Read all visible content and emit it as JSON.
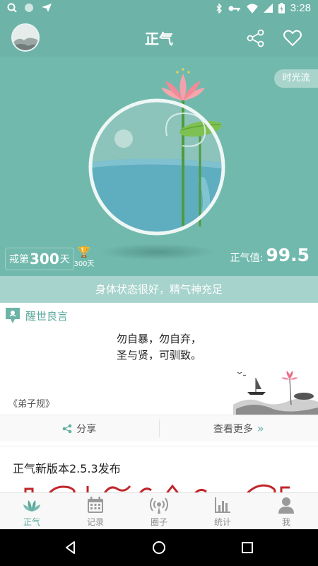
{
  "status_bar": {
    "time": "3:28"
  },
  "header": {
    "title": "正气"
  },
  "hero": {
    "timeflow_label": "时光流",
    "streak_prefix": "戒第",
    "streak_days": "300",
    "streak_suffix": "天",
    "trophy_label": "300天",
    "score_label": "正气值:",
    "score_value": "99.5",
    "water_level": 0.55
  },
  "banner": {
    "text": "身体状态很好，精气神充足"
  },
  "quote": {
    "title": "醒世良言",
    "line1": "勿自暴，勿自弃，",
    "line2": "圣与贤，可驯致。",
    "source": "《弟子规》",
    "share_label": "分享",
    "more_label": "查看更多"
  },
  "news": {
    "title": "正气新版本2.5.3发布"
  },
  "tabs": [
    {
      "label": "正气",
      "icon": "lotus-icon",
      "active": true
    },
    {
      "label": "记录",
      "icon": "calendar-icon",
      "active": false
    },
    {
      "label": "圈子",
      "icon": "broadcast-icon",
      "active": false
    },
    {
      "label": "统计",
      "icon": "bar-chart-icon",
      "active": false
    },
    {
      "label": "我",
      "icon": "person-icon",
      "active": false
    }
  ],
  "colors": {
    "primary": "#6db3a8",
    "accent": "#5aa99c",
    "lotus": "#f08b9a"
  }
}
